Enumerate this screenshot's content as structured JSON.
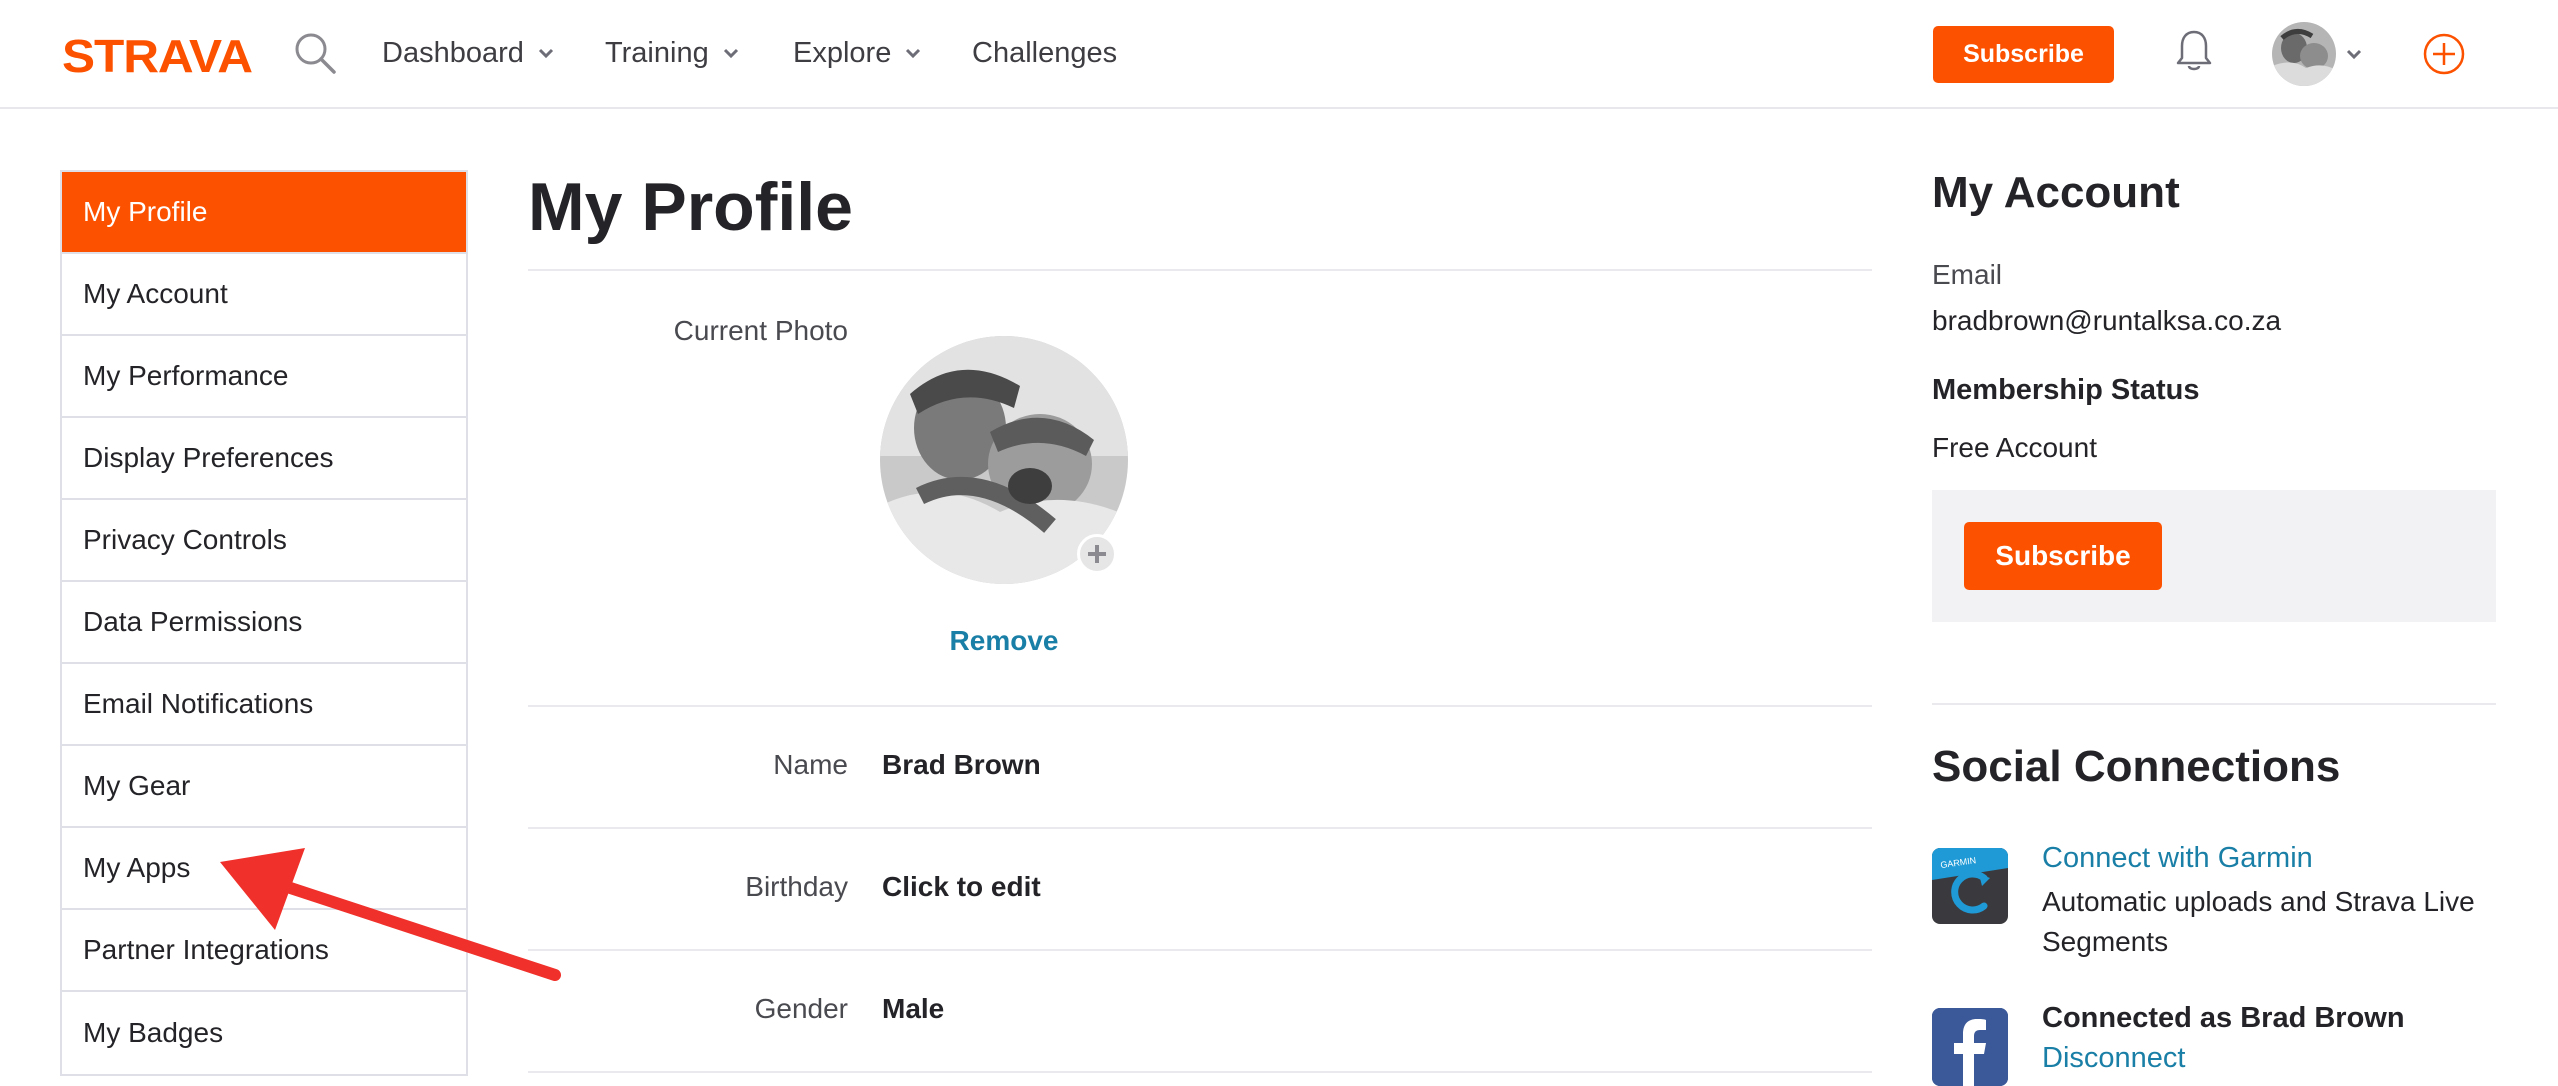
{
  "header": {
    "logo_text": "STRAVA",
    "nav": [
      {
        "label": "Dashboard",
        "has_dropdown": true
      },
      {
        "label": "Training",
        "has_dropdown": true
      },
      {
        "label": "Explore",
        "has_dropdown": true
      },
      {
        "label": "Challenges",
        "has_dropdown": false
      }
    ],
    "subscribe_label": "Subscribe"
  },
  "sidebar": {
    "items": [
      {
        "label": "My Profile",
        "active": true
      },
      {
        "label": "My Account"
      },
      {
        "label": "My Performance"
      },
      {
        "label": "Display Preferences"
      },
      {
        "label": "Privacy Controls"
      },
      {
        "label": "Data Permissions"
      },
      {
        "label": "Email Notifications"
      },
      {
        "label": "My Gear"
      },
      {
        "label": "My Apps"
      },
      {
        "label": "Partner Integrations"
      },
      {
        "label": "My Badges"
      }
    ]
  },
  "main": {
    "title": "My Profile",
    "photo_label": "Current Photo",
    "remove_label": "Remove",
    "fields": [
      {
        "label": "Name",
        "value": "Brad Brown"
      },
      {
        "label": "Birthday",
        "value": "Click to edit"
      },
      {
        "label": "Gender",
        "value": "Male"
      }
    ]
  },
  "account": {
    "title": "My Account",
    "email_label": "Email",
    "email_value": "bradbrown@runtalksa.co.za",
    "membership_label": "Membership Status",
    "membership_value": "Free Account",
    "subscribe_label": "Subscribe"
  },
  "social": {
    "title": "Social Connections",
    "garmin_link": "Connect with Garmin",
    "garmin_desc": "Automatic uploads and Strava Live Segments",
    "garmin_icon_text": "GARMIN",
    "facebook_status": "Connected as Brad Brown",
    "facebook_link": "Disconnect"
  },
  "colors": {
    "brand_orange": "#fc5200",
    "link_blue": "#1a7fa6",
    "annotation_red": "#f0302a"
  },
  "icons": [
    "search-icon",
    "chevron-down-icon",
    "bell-icon",
    "plus-circle-icon",
    "garmin-connect-icon",
    "facebook-icon",
    "annotation-arrow"
  ]
}
